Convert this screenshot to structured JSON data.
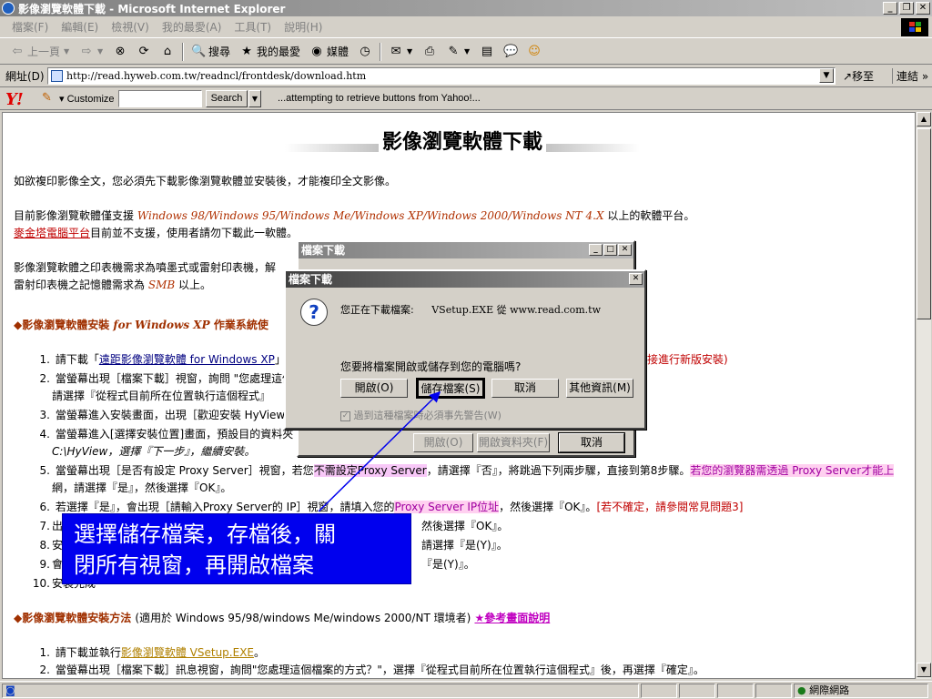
{
  "window": {
    "title": "影像瀏覽軟體下載 - Microsoft Internet Explorer"
  },
  "menu": [
    "檔案(F)",
    "編輯(E)",
    "檢視(V)",
    "我的最愛(A)",
    "工具(T)",
    "說明(H)"
  ],
  "toolbar": {
    "back": "上一頁",
    "search": "搜尋",
    "favorites": "我的最愛",
    "media": "媒體"
  },
  "address": {
    "label": "網址(D)",
    "url": "http://read.hyweb.com.tw/readncl/frontdesk/download.htm",
    "go": "移至",
    "links": "連結"
  },
  "yahoo": {
    "logo": "Y!",
    "customize": "Customize",
    "search_label": "Search",
    "status": "...attempting to retrieve buttons from Yahoo!..."
  },
  "page": {
    "title": "影像瀏覽軟體下載",
    "intro": "如欲複印影像全文，您必須先下載影像瀏覽軟體並安裝後，才能複印全文影像。",
    "platform_pre": "目前影像瀏覽軟體僅支援",
    "platform_list": "Windows 98/Windows 95/Windows Me/Windows XP/Windows 2000/Windows NT 4.X",
    "platform_post": "以上的軟體平台。",
    "mac_link": "麥金塔電腦平台",
    "mac_text": "目前並不支援，使用者請勿下載此一軟體。",
    "printer_line1": "影像瀏覽軟體之印表機需求為噴墨式或雷射印表機，解",
    "printer_line2_pre": "雷射印表機之記憶體需求為",
    "printer_smb": "SMB",
    "printer_line2_post": "以上。",
    "section1_pre": "◆影像瀏覽軟體安裝",
    "section1_for": "for Windows XP",
    "section1_post": "作業系統使",
    "items": [
      {
        "num": "1.",
        "pre": "請下載「",
        "link": "遠距影像瀏覽軟體 for Windows XP",
        "post": "」(",
        "tail": "接進行新版安裝)"
      },
      {
        "num": "2.",
        "text": "當螢幕出現［檔案下載］視窗，詢問 \"您處理這個",
        "line2": "請選擇『從程式目前所在位置執行這個程式』"
      },
      {
        "num": "3.",
        "text": "當螢幕進入安裝畫面，出現［歡迎安裝 HyView 影"
      },
      {
        "num": "4.",
        "text": "當螢幕進入[選擇安裝位置]畫面，預設目的資料夾",
        "line2": "C:\\HyView，選擇『下一步』，繼續安裝。"
      },
      {
        "num": "5.",
        "pre": "當螢幕出現［是否有設定 Proxy Server］視窗，若您",
        "hl": "不需設定Proxy Server",
        "mid": "，請選擇『否』，將跳過下列兩步驟，直接到第8步驟。",
        "hl2": "若您的瀏覽器需透過 Proxy Server才能上",
        "line2": "網，請選擇『是』，然後選擇『OK』。"
      },
      {
        "num": "6.",
        "pre": "若選擇『是』，會出現［請輸入Proxy Server的 IP］視窗，請填入您的",
        "hl": "Proxy Server IP位址",
        "mid": "，然後選擇『OK』。",
        "tail": "[若不確定，請參閱常見問題3]"
      },
      {
        "num": "7.",
        "text": "出",
        "right": "然後選擇『OK』。"
      },
      {
        "num": "8.",
        "text": "安",
        "right": "請選擇『是(Y)』。"
      },
      {
        "num": "9.",
        "text": "會",
        "right": "『是(Y)』。"
      },
      {
        "num": "10.",
        "text": "安裝完成"
      }
    ],
    "section2_title": "◆影像瀏覽軟體安裝方法",
    "section2_paren": "(適用於 Windows 95/98/windows Me/windows 2000/NT 環境者)",
    "section2_link": "★參考畫面說明",
    "items2": [
      {
        "num": "1.",
        "pre": "請下載並執行",
        "link": "影像瀏覽軟體 VSetup.EXE",
        "post": "。"
      },
      {
        "num": "2.",
        "text": "當螢幕出現［檔案下載］訊息視窗，詢問\"您處理這個檔案的方式？\"，選擇『從程式目前所在位置執行這個程式』後，再選擇『確定』。"
      }
    ]
  },
  "dialog_back": {
    "title": "檔案下載",
    "open": "開啟(O)",
    "open_folder": "開啟資料夾(F)",
    "cancel": "取消"
  },
  "dialog_front": {
    "title": "檔案下載",
    "downloading_label": "您正在下載檔案:",
    "filename": "VSetup.EXE 從 www.read.com.tw",
    "question": "您要將檔案開啟或儲存到您的電腦嗎?",
    "open": "開啟(O)",
    "save": "儲存檔案(S)",
    "cancel": "取消",
    "more_info": "其他資訊(M)",
    "always_ask": "過到這種檔案時必須事先警告(W)"
  },
  "callout": {
    "line1": "選擇儲存檔案，存檔後，關",
    "line2": "閉所有視窗，再開啟檔案"
  },
  "status": {
    "zone": "網際網路"
  }
}
